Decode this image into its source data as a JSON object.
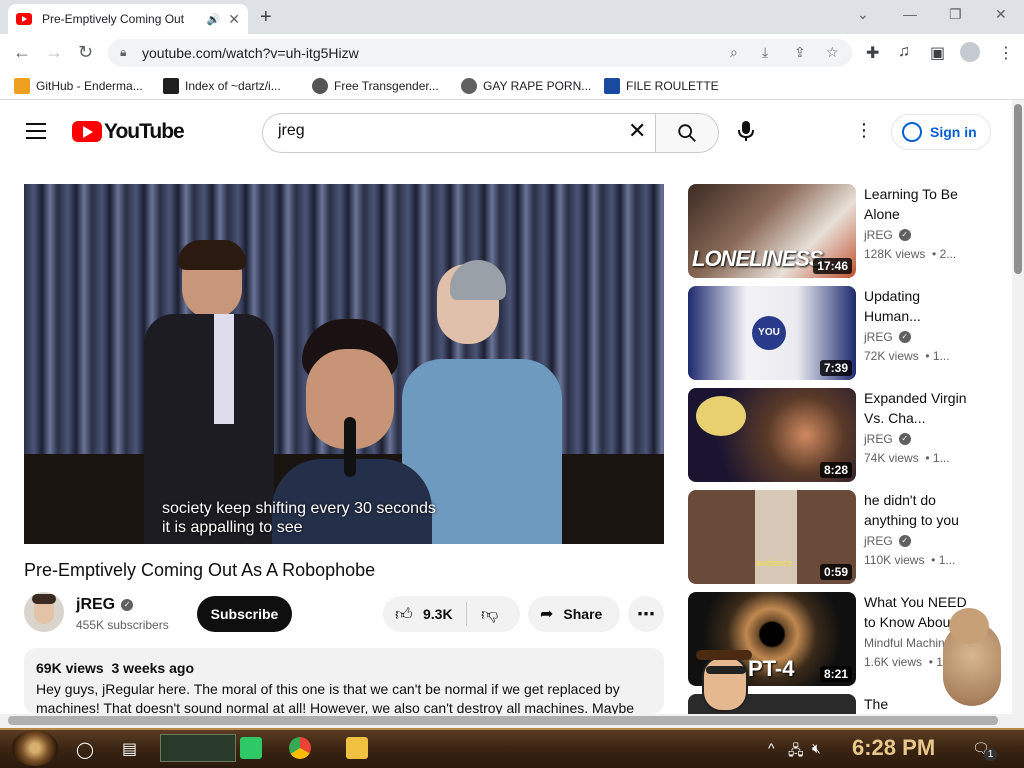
{
  "browser": {
    "tab_title": "Pre-Emptively Coming Out",
    "tab_speaker": "🔊",
    "tab_close": "✕",
    "new_tab": "+",
    "url": "youtube.com/watch?v=uh-itg5Hizw",
    "bookmarks": [
      {
        "label": "GitHub - Enderma...",
        "favicon_color": "#f0a020"
      },
      {
        "label": "Index of ~dartz/i...",
        "favicon_color": "#202020"
      },
      {
        "label": "Free Transgender...",
        "favicon_color": "#555555"
      },
      {
        "label": "GAY RAPE PORN...",
        "favicon_color": "#606060"
      },
      {
        "label": "FILE ROULETTE",
        "favicon_color": "#1a4aa0"
      }
    ]
  },
  "youtube": {
    "logo_text": "YouTube",
    "search_value": "jreg",
    "signin_label": "Sign in",
    "brand_color": "#ff0000",
    "link_color": "#065fd4"
  },
  "video": {
    "caption_line1": "society keep shifting every 30 seconds",
    "caption_line2": "it is appalling to see",
    "title": "Pre-Emptively Coming Out As A Robophobe",
    "channel": "jREG",
    "subscribers": "455K subscribers",
    "subscribe_label": "Subscribe",
    "likes": "9.3K",
    "share_label": "Share",
    "views": "69K views",
    "age": "3 weeks ago",
    "description": "Hey guys, jRegular here. The moral of this one is that we can't be normal if we get replaced by machines! That doesn't sound normal at all! However, we also can't destroy all machines. Maybe we"
  },
  "sidebar": [
    {
      "title": "Learning To Be Alone",
      "channel": "jREG",
      "views": "128K views",
      "age": "• 2...",
      "duration": "17:46",
      "thumb_text": "LONELINESS"
    },
    {
      "title": "Updating Human...",
      "channel": "jREG",
      "views": "72K views",
      "age": "• 1...",
      "duration": "7:39",
      "thumb_text": "YOU"
    },
    {
      "title": "Expanded Virgin Vs. Cha...",
      "channel": "jREG",
      "views": "74K views",
      "age": "• 1...",
      "duration": "8:28",
      "thumb_text": ""
    },
    {
      "title": "he didn't do anything to you",
      "channel": "jREG",
      "views": "110K views",
      "age": "• 1...",
      "duration": "0:59",
      "thumb_text": "audience"
    },
    {
      "title": "What You NEED to Know Abou...",
      "channel": "Mindful Machin...",
      "views": "1.6K views",
      "age": "• 1",
      "duration": "8:21",
      "thumb_text": "PT-4"
    },
    {
      "title": "The",
      "channel": "",
      "views": "",
      "age": "",
      "duration": "",
      "thumb_text": ""
    }
  ],
  "taskbar": {
    "time": "6:28 PM",
    "notification_count": "1"
  }
}
